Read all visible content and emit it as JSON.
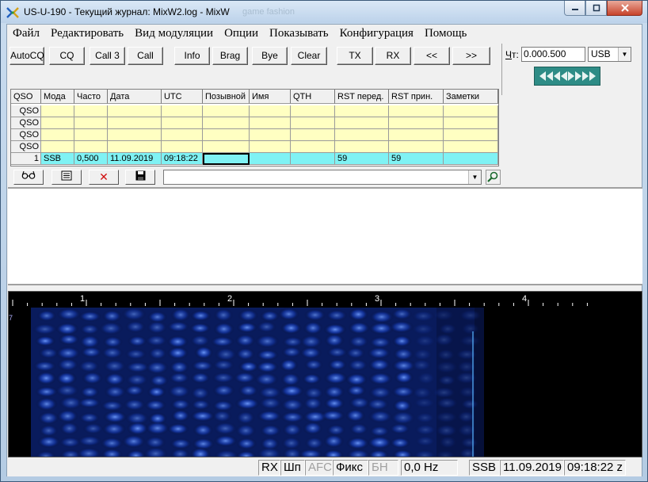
{
  "window": {
    "title": "US-U-190 - Текущий журнал: MixW2.log - MixW",
    "ghost_title": "game fashion",
    "controls": [
      "minimize",
      "maximize",
      "close"
    ]
  },
  "menu": [
    "Файл",
    "Редактировать",
    "Вид модуляции",
    "Опции",
    "Показывать",
    "Конфигурация",
    "Помощь"
  ],
  "toolbar": {
    "buttons": [
      "AutoCQ",
      "CQ",
      "Call 3",
      "Call",
      "Info",
      "Brag",
      "Bye",
      "Clear",
      "TX",
      "RX",
      "<<",
      ">>"
    ]
  },
  "channel": {
    "label_prefix": "Ч",
    "label_suffix": "т:",
    "frequency": "0.000.500",
    "mode": "USB"
  },
  "log": {
    "columns": [
      "QSO",
      "Мода",
      "Часто",
      "Дата",
      "UTC",
      "Позывной",
      "Имя",
      "QTH",
      "RST перед.",
      "RST прин.",
      "Заметки"
    ],
    "empty_rows": [
      "QSO",
      "QSO",
      "QSO",
      "QSO"
    ],
    "current_row": {
      "num": "1",
      "mode": "SSB",
      "freq": "0,500",
      "date": "11.09.2019",
      "utc": "09:18:22",
      "call": "",
      "name": "",
      "qth": "",
      "rst_sent": "59",
      "rst_rcvd": "59",
      "notes": ""
    }
  },
  "grid_tools": {
    "icons": [
      "glasses-icon",
      "note-icon",
      "delete-icon",
      "save-icon"
    ],
    "delete_glyph": "✕",
    "callsign_value": ""
  },
  "waterfall": {
    "scale_labels": [
      "1",
      "2",
      "3",
      "4"
    ],
    "left_marker": "7",
    "scale_color": "#ffffff",
    "signal_color": "#1a44c8",
    "carrier_line_color": "#5ab8ff"
  },
  "status": {
    "rx": "RX",
    "sp": "Шп",
    "afc": "AFC",
    "fix": "Фикс",
    "bn": "БН",
    "offset": "0,0 Hz",
    "mode": "SSB",
    "date": "11.09.2019",
    "time": "09:18:22 z"
  }
}
